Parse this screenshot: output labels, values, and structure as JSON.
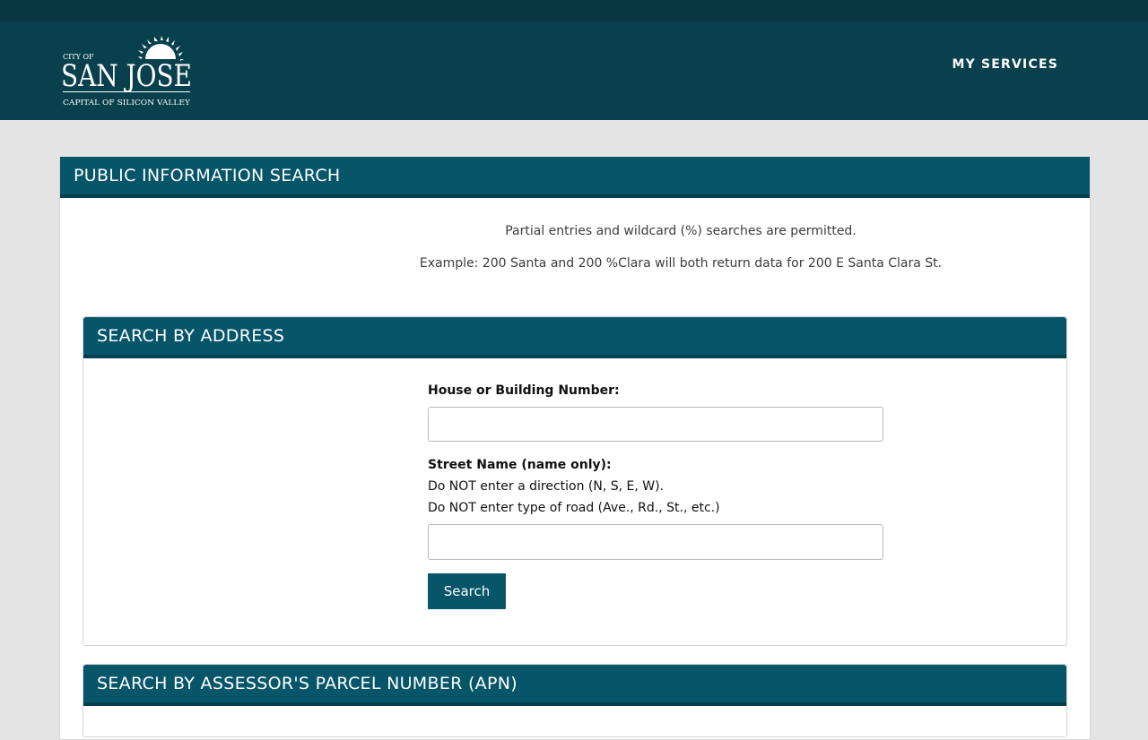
{
  "header": {
    "logo": {
      "city_of": "CITY OF",
      "name": "SAN JOSE",
      "tagline": "CAPITAL OF SILICON VALLEY"
    },
    "nav": {
      "my_services": "MY SERVICES"
    }
  },
  "main": {
    "title": "PUBLIC INFORMATION SEARCH",
    "note_wildcard": "Partial entries and wildcard (%) searches are permitted.",
    "note_example": "Example: 200 Santa and 200 %Clara will both return data for 200 E Santa Clara St."
  },
  "search_by_address": {
    "title": "SEARCH BY ADDRESS",
    "house_label": "House or Building Number:",
    "house_value": "",
    "street_label": "Street Name (name only):",
    "street_hint_direction": "Do NOT enter a direction (N, S, E, W).",
    "street_hint_road": "Do NOT enter type of road (Ave., Rd., St., etc.)",
    "street_value": "",
    "search_button": "Search"
  },
  "search_by_apn": {
    "title": "SEARCH BY ASSESSOR'S PARCEL NUMBER (APN)"
  },
  "colors": {
    "header_bg": "#08404d",
    "panel_header_bg": "#065569",
    "page_bg": "#e4e4e4"
  }
}
